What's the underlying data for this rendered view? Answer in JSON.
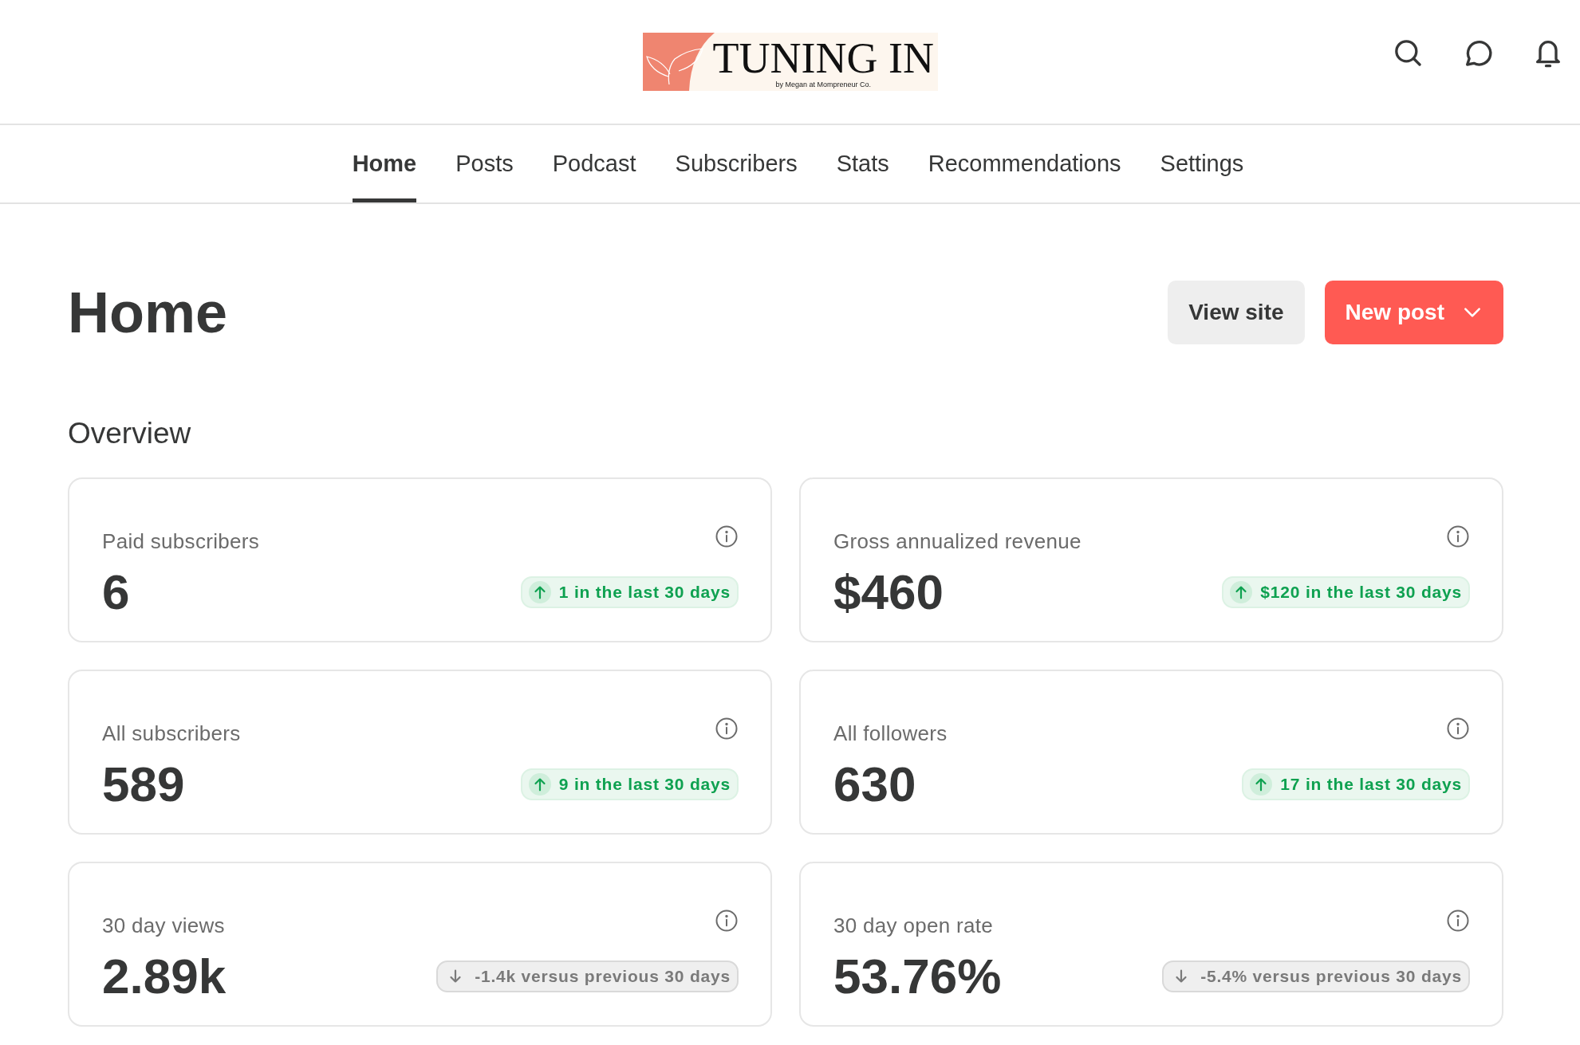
{
  "logo": {
    "title": "TUNING IN",
    "subtitle": "by Megan at Mompreneur Co."
  },
  "nav": [
    {
      "label": "Home",
      "selected": true
    },
    {
      "label": "Posts",
      "selected": false
    },
    {
      "label": "Podcast",
      "selected": false
    },
    {
      "label": "Subscribers",
      "selected": false
    },
    {
      "label": "Stats",
      "selected": false
    },
    {
      "label": "Recommendations",
      "selected": false
    },
    {
      "label": "Settings",
      "selected": false
    }
  ],
  "page_title": "Home",
  "buttons": {
    "view_site": "View site",
    "new_post": "New post"
  },
  "overview": {
    "heading": "Overview",
    "cards": [
      {
        "label": "Paid subscribers",
        "value": "6",
        "kind": "up",
        "change": "1 in the last 30 days"
      },
      {
        "label": "Gross annualized revenue",
        "value": "$460",
        "kind": "up",
        "change": "$120 in the last 30 days"
      },
      {
        "label": "All subscribers",
        "value": "589",
        "kind": "up",
        "change": "9 in the last 30 days"
      },
      {
        "label": "All followers",
        "value": "630",
        "kind": "up",
        "change": "17 in the last 30 days"
      },
      {
        "label": "30 day views",
        "value": "2.89k",
        "kind": "down",
        "change": "-1.4k versus previous 30 days"
      },
      {
        "label": "30 day open rate",
        "value": "53.76%",
        "kind": "down",
        "change": "-5.4% versus previous 30 days"
      }
    ]
  }
}
